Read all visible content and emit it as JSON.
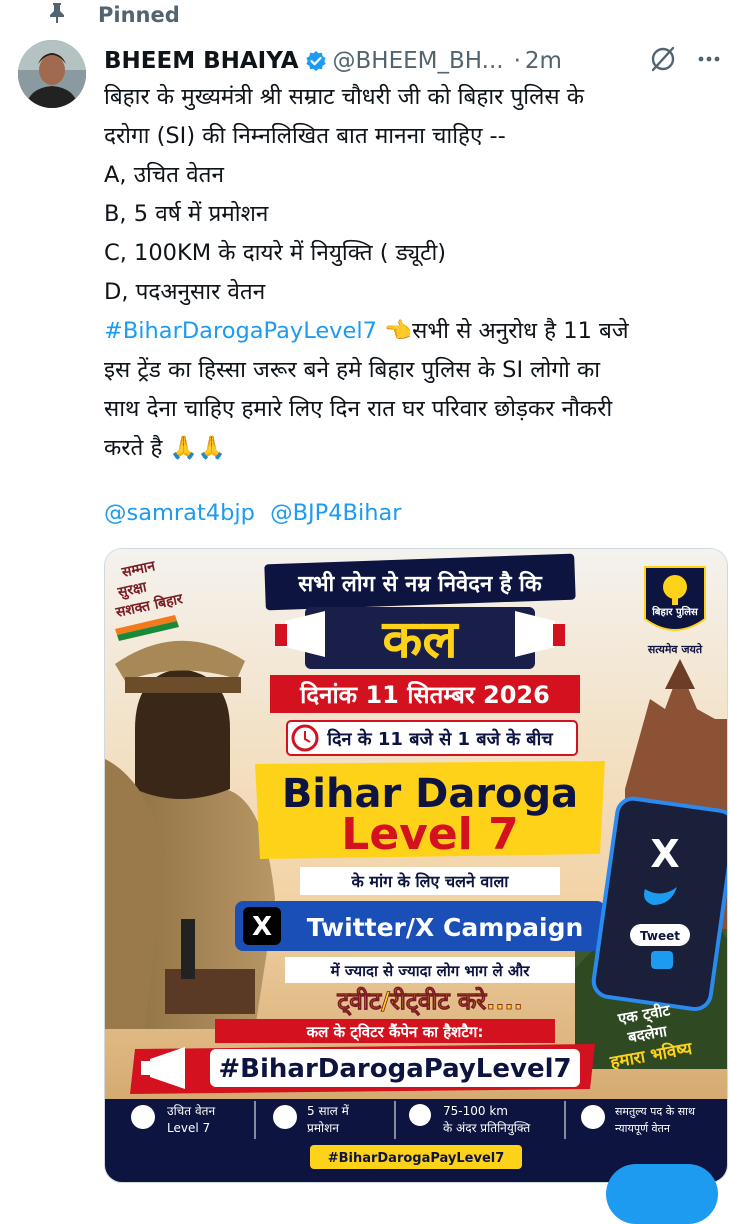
{
  "pinned": {
    "label": "Pinned"
  },
  "tweet": {
    "author_name": "BHEEM BHAIYA",
    "handle": "@BHEEM_BH...",
    "separator": "·",
    "time": "2m",
    "lines": [
      "बिहार के मुख्यमंत्री श्री सम्राट चौधरी जी को बिहार पुलिस के",
      "दरोगा (SI) की निम्नलिखित बात मानना चाहिए --",
      "A, उचित वेतन",
      "B, 5 वर्ष में प्रमोशन",
      "C, 100KM के दायरे में नियुक्ति ( ड्यूटी)",
      "D, पदअनुसार वेतन"
    ],
    "hashtag": "#BiharDarogaPayLevel7",
    "hashtag_emoji": "👈",
    "hashtag_follow": "सभी से अनुरोध है 11 बजे",
    "lines2": [
      "इस ट्रेंड का हिस्सा जरूर बने हमे बिहार पुलिस के SI लोगो का",
      "साथ देना चाहिए हमारे लिए दिन रात घर परिवार छोड़कर नौकरी",
      "करते है 🙏🙏"
    ],
    "mentions": [
      "@samrat4bjp",
      "@BJP4Bihar"
    ]
  },
  "poster": {
    "badge_lines": [
      "सम्मान",
      "सुरक्षा",
      "सशक्त बिहार"
    ],
    "top_banner": "सभी लोग से नम्र निवेदन है कि",
    "big_word": "कल",
    "date_label": "दिनांक 11 सितम्बर 2026",
    "time_label": "दिन के 11 बजे से 1 बजे के बीच",
    "title_line1": "Bihar Daroga",
    "title_line2": "Level 7",
    "sub1": "के मांग के लिए चलने वाला",
    "campaign": "Twitter/X Campaign",
    "x_letter": "X",
    "sub2": "में ज्यादा से ज्यादा लोग भाग ले और",
    "sub3": "ट्वीट/रीट्वीट करे....",
    "hashtag_intro": "कल के ट्विटर कैंपेन का हैशटैग:",
    "hashtag_big": "#BiharDarogaPayLevel7",
    "logo_text": "बिहार पुलिस",
    "motto": "सत्यमेव जयते",
    "phone_x": "X",
    "phone_tweet": "Tweet",
    "slogan_lines": [
      "एक ट्वीट",
      "बदलेगा",
      "हमारा भविष्य"
    ],
    "features": [
      {
        "l1": "उचित वेतन",
        "l2": "Level 7"
      },
      {
        "l1": "5 साल में",
        "l2": "प्रमोशन"
      },
      {
        "l1": "75-100 km",
        "l2": "के अंदर प्रतिनियुक्ति"
      },
      {
        "l1": "समतुल्य पद के साथ",
        "l2": "न्यायपूर्ण वेतन"
      }
    ],
    "footer_hashtag": "#BiharDarogaPayLevel7"
  },
  "colors": {
    "link": "#1d9bf0",
    "muted": "#536471",
    "verified": "#1d9bf0",
    "poster_red": "#d4121f",
    "poster_yellow": "#ffd21a",
    "poster_navy": "#0d1440"
  }
}
